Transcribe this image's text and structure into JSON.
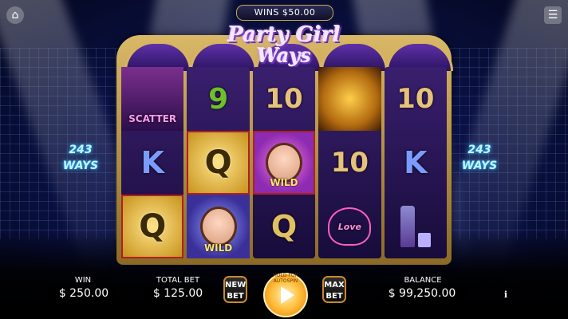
{
  "header": {
    "wins_text": "WINS $50.00",
    "logo_line1": "Party Girl",
    "logo_line2": "Ways"
  },
  "side_badges": {
    "left": "243\nWAYS",
    "right": "243\nWAYS",
    "left_l1": "243",
    "left_l2": "WAYS",
    "right_l1": "243",
    "right_l2": "WAYS"
  },
  "reels": [
    [
      {
        "symbol": "scatter",
        "label": "SCATTER"
      },
      {
        "symbol": "K",
        "label": "K"
      },
      {
        "symbol": "Q",
        "label": "Q",
        "highlight": true
      }
    ],
    [
      {
        "symbol": "9",
        "label": "9"
      },
      {
        "symbol": "Q",
        "label": "Q",
        "highlight": true
      },
      {
        "symbol": "wild",
        "label": "WILD"
      }
    ],
    [
      {
        "symbol": "10",
        "label": "10"
      },
      {
        "symbol": "wild",
        "label": "WILD",
        "highlight": true
      },
      {
        "symbol": "Q",
        "label": "Q"
      }
    ],
    [
      {
        "symbol": "disco-ball",
        "label": ""
      },
      {
        "symbol": "10",
        "label": "10"
      },
      {
        "symbol": "love",
        "label": "Love"
      }
    ],
    [
      {
        "symbol": "10",
        "label": "10"
      },
      {
        "symbol": "K",
        "label": "K"
      },
      {
        "symbol": "bottle",
        "label": ""
      }
    ]
  ],
  "bottom_bar": {
    "win_label": "WIN",
    "win_value": "$ 250.00",
    "total_bet_label": "TOTAL BET",
    "total_bet_value": "$ 125.00",
    "new_bet_l1": "NEW",
    "new_bet_l2": "BET",
    "spin_hint": "HOLD FOR AUTOSPIN",
    "max_bet_l1": "MAX",
    "max_bet_l2": "BET",
    "balance_label": "BALANCE",
    "balance_value": "$ 99,250.00",
    "info_icon": "i"
  },
  "colors": {
    "highlight_border": "#b12020",
    "frame_gold": "#d9b867",
    "spin_orange": "#ffbd38"
  }
}
